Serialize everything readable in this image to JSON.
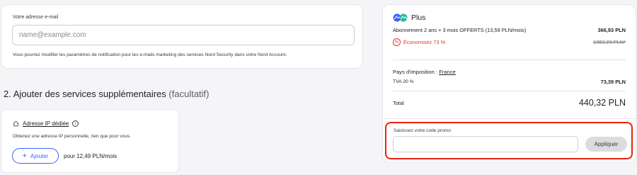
{
  "email": {
    "label": "Votre adresse e-mail",
    "placeholder": "name@example.com",
    "value": "",
    "note": "Vous pourrez modifier les paramètres de notification pour les e-mails marketing des services Nord Security dans votre Nord Account."
  },
  "section": {
    "title": "2. Ajouter des services supplémentaires",
    "optional": "(facultatif)"
  },
  "ip_service": {
    "title": "Adresse IP dédiée",
    "info_icon": "info-icon",
    "home_icon": "home-icon",
    "description": "Obtenez une adresse IP personnelle, rien que pour vous.",
    "add_label": "Ajouter",
    "price": "pour 12,49 PLN/mois"
  },
  "summary": {
    "plan_name": "Plus",
    "subscription_label": "Abonnement 2 ans + 3 mois OFFERTS (13,59 PLN/mois)",
    "subscription_price": "366,93 PLN",
    "savings_label": "Économisez 73 %",
    "original_price": "1363,23 PLN*",
    "country_label": "Pays d'imposition :",
    "country": "France",
    "vat_label": "TVA 20 %",
    "vat_amount": "73,39 PLN",
    "total_label": "Total",
    "total_amount": "440,32 PLN"
  },
  "promo": {
    "label": "Saisissez votre code promo",
    "placeholder": "",
    "button": "Appliquer"
  },
  "colors": {
    "accent": "#3e5fff",
    "savings": "#e8352b",
    "highlight": "#e8230e"
  }
}
